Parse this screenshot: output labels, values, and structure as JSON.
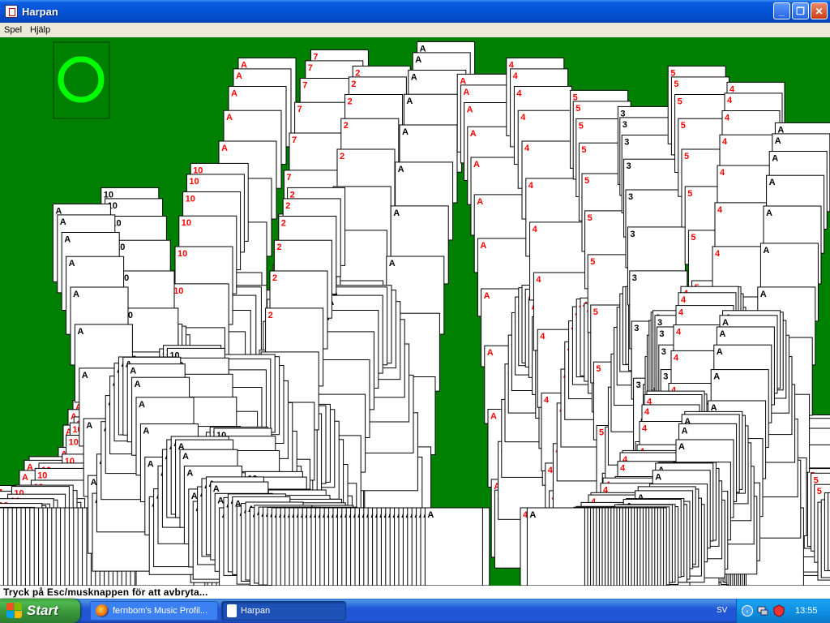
{
  "window": {
    "title": "Harpan",
    "min_label": "_",
    "max_label": "❐",
    "close_label": "✕"
  },
  "menu": {
    "items": [
      "Spel",
      "Hjälp"
    ]
  },
  "game": {
    "status_text": "Tryck på Esc/musknappen för att avbryta...",
    "felt_color": "#008000",
    "deck_ring_color": "#00ff00",
    "red_suit_color": "#ff0000",
    "cascade_ranks": [
      "A",
      "2",
      "3",
      "4",
      "5",
      "7",
      "10"
    ]
  },
  "taskbar": {
    "start_label": "Start",
    "tasks": [
      {
        "label": "fernbom's Music Profil...",
        "icon": "firefox-icon"
      },
      {
        "label": "Harpan",
        "icon": "solitaire-icon"
      }
    ],
    "language": "SV",
    "clock": "13:55"
  }
}
